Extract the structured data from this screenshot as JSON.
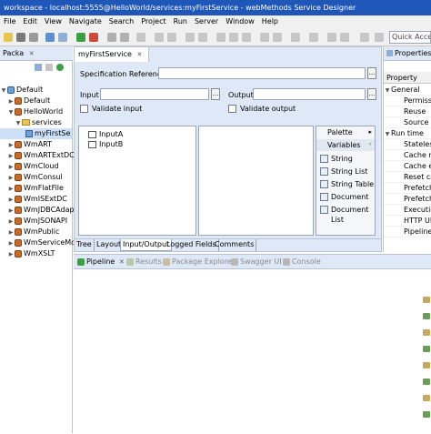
{
  "window": {
    "title": "workspace - localhost:5555@HelloWorld/services:myFirstService - webMethods Service Designer"
  },
  "menu": [
    "File",
    "Edit",
    "View",
    "Navigate",
    "Search",
    "Project",
    "Run",
    "Server",
    "Window",
    "Help"
  ],
  "toolbar": {
    "quick_access": "Quick Access"
  },
  "left_panel": {
    "tab_label": "Packa",
    "tree": [
      {
        "label": "Default",
        "kind": "root",
        "indent": 0,
        "expanded": true
      },
      {
        "label": "Default",
        "kind": "package",
        "indent": 1,
        "expanded": false
      },
      {
        "label": "HelloWorld",
        "kind": "package",
        "indent": 1,
        "expanded": true
      },
      {
        "label": "services",
        "kind": "folder",
        "indent": 2,
        "expanded": true
      },
      {
        "label": "myFirstSe",
        "kind": "service",
        "indent": 3,
        "expanded": false
      },
      {
        "label": "WmART",
        "kind": "package",
        "indent": 1,
        "expanded": false
      },
      {
        "label": "WmARTExtDC",
        "kind": "package",
        "indent": 1,
        "expanded": false
      },
      {
        "label": "WmCloud",
        "kind": "package",
        "indent": 1,
        "expanded": false
      },
      {
        "label": "WmConsul",
        "kind": "package",
        "indent": 1,
        "expanded": false
      },
      {
        "label": "WmFlatFile",
        "kind": "package",
        "indent": 1,
        "expanded": false
      },
      {
        "label": "WmISExtDC",
        "kind": "package",
        "indent": 1,
        "expanded": false
      },
      {
        "label": "WmJDBCAdap",
        "kind": "package",
        "indent": 1,
        "expanded": false
      },
      {
        "label": "WmJSONAPI",
        "kind": "package",
        "indent": 1,
        "expanded": false
      },
      {
        "label": "WmPublic",
        "kind": "package",
        "indent": 1,
        "expanded": false
      },
      {
        "label": "WmServiceMo",
        "kind": "package",
        "indent": 1,
        "expanded": false
      },
      {
        "label": "WmXSLT",
        "kind": "package",
        "indent": 1,
        "expanded": false
      }
    ]
  },
  "editor": {
    "tab_label": "myFirstService",
    "spec_label": "Specification Reference",
    "input_label": "Input",
    "output_label": "Output",
    "validate_input": "Validate input",
    "validate_output": "Validate output",
    "ellipsis": "...",
    "inputs": [
      "InputA",
      "InputB"
    ],
    "palette": {
      "title": "Palette",
      "group": "Variables",
      "items": [
        "String",
        "String List",
        "String Table",
        "Document",
        "Document List"
      ]
    },
    "bottom_tabs": [
      "Tree",
      "Layout",
      "Input/Output",
      "Logged Fields",
      "Comments"
    ],
    "active_bottom_tab": "Input/Output"
  },
  "properties": {
    "tab_label": "Properties",
    "column": "Property",
    "groups": [
      {
        "label": "General",
        "items": [
          "Permissi",
          "Reuse",
          "Source U"
        ]
      },
      {
        "label": "Run time",
        "items": [
          "Stateles",
          "Cache re",
          "Cache e",
          "Reset ca",
          "Prefetch",
          "Prefetch",
          "Executio",
          "HTTP UR",
          "Pipeline"
        ]
      }
    ]
  },
  "lower_views": {
    "tabs": [
      "Pipeline",
      "Results",
      "Package Explorer",
      "Swagger UI",
      "Console"
    ],
    "active_tab": "Pipeline"
  },
  "colors": {
    "title_bar": "#1f57b8",
    "panel_tab": "#dfe8f6",
    "package_icon": "#c86a2a"
  }
}
